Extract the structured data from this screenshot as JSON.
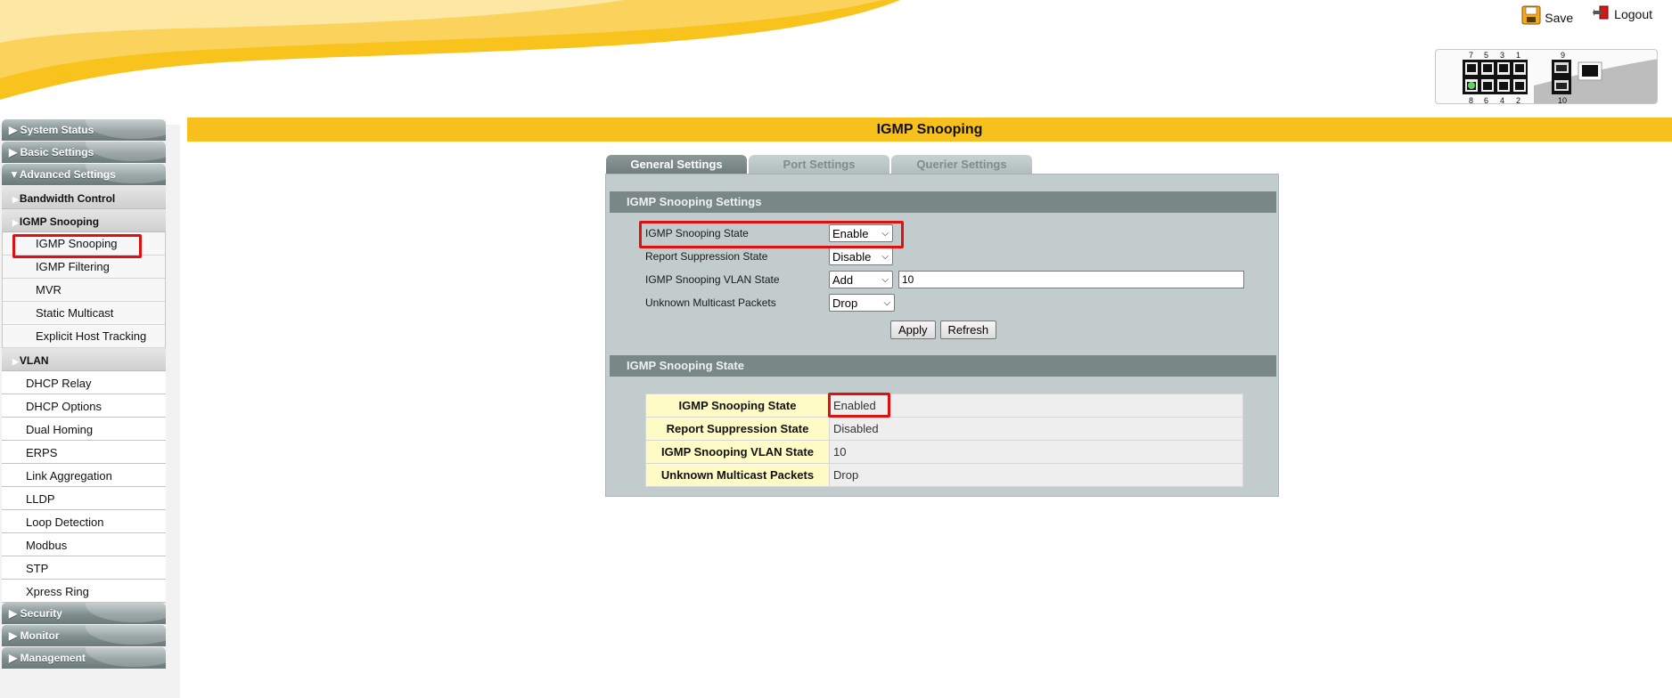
{
  "header": {
    "save_label": "Save",
    "logout_label": "Logout",
    "ports_top": [
      "7",
      "5",
      "3",
      "1",
      "9"
    ],
    "ports_bottom": [
      "8",
      "6",
      "4",
      "2",
      "10"
    ]
  },
  "sidebar": {
    "system_status": "System Status",
    "basic_settings": "Basic Settings",
    "advanced_settings": "Advanced Settings",
    "bandwidth_control": "Bandwidth Control",
    "igmp_group": "IGMP Snooping",
    "igmp_items": [
      "IGMP Snooping",
      "IGMP Filtering",
      "MVR",
      "Static Multicast",
      "Explicit Host Tracking"
    ],
    "vlan": "VLAN",
    "plain_items": [
      "DHCP Relay",
      "DHCP Options",
      "Dual Homing",
      "ERPS",
      "Link Aggregation",
      "LLDP",
      "Loop Detection",
      "Modbus",
      "STP",
      "Xpress Ring"
    ],
    "security": "Security",
    "monitor": "Monitor",
    "management": "Management"
  },
  "page": {
    "title": "IGMP Snooping",
    "tabs": [
      "General Settings",
      "Port Settings",
      "Querier Settings"
    ]
  },
  "settings": {
    "section_title": "IGMP Snooping Settings",
    "state_label": "IGMP Snooping State",
    "state_value": "Enable",
    "suppression_label": "Report Suppression State",
    "suppression_value": "Disable",
    "vlan_label": "IGMP Snooping VLAN State",
    "vlan_action": "Add",
    "vlan_value": "10",
    "unknown_label": "Unknown Multicast Packets",
    "unknown_value": "Drop",
    "apply_label": "Apply",
    "refresh_label": "Refresh"
  },
  "status": {
    "section_title": "IGMP Snooping State",
    "rows": [
      {
        "key": "IGMP Snooping State",
        "value": "Enabled"
      },
      {
        "key": "Report Suppression State",
        "value": "Disabled"
      },
      {
        "key": "IGMP Snooping VLAN State",
        "value": "10"
      },
      {
        "key": "Unknown Multicast Packets",
        "value": "Drop"
      }
    ]
  },
  "colors": {
    "accent": "#f7c01c",
    "highlight": "#e01010",
    "section_head": "#7a8787",
    "panel": "#c2cccc"
  }
}
